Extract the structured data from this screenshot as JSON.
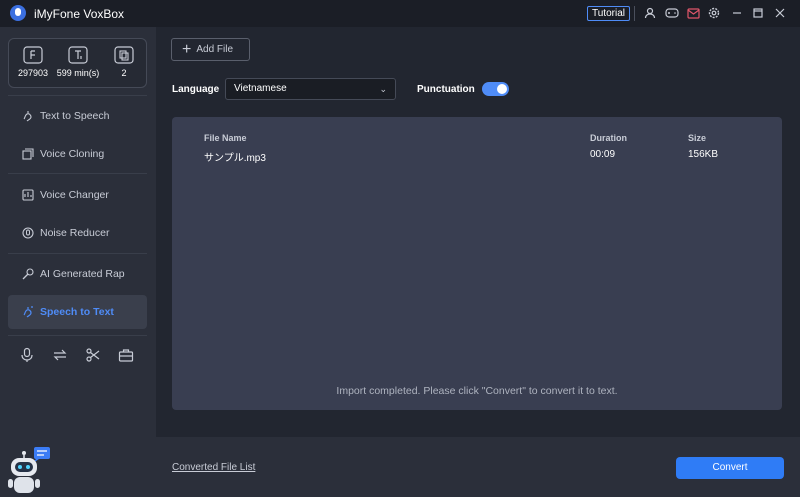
{
  "app": {
    "title": "iMyFone VoxBox",
    "accent": "#4f8cf7"
  },
  "titlebar": {
    "tutorial_label": "Tutorial",
    "icons": [
      "user-icon",
      "gamepad-icon",
      "mail-icon",
      "settings-icon",
      "minimize-icon",
      "maximize-icon",
      "close-icon"
    ]
  },
  "stats": [
    {
      "icon": "characters-icon",
      "value": "297903"
    },
    {
      "icon": "minutes-icon",
      "value": "599 min(s)"
    },
    {
      "icon": "files-icon",
      "value": "2"
    }
  ],
  "sidebar": {
    "items": [
      {
        "label": "Text to Speech",
        "icon": "text-to-speech-icon"
      },
      {
        "label": "Voice Cloning",
        "icon": "voice-cloning-icon"
      },
      {
        "label": "Voice Changer",
        "icon": "voice-changer-icon"
      },
      {
        "label": "Noise Reducer",
        "icon": "noise-reducer-icon"
      },
      {
        "label": "AI Generated Rap",
        "icon": "ai-rap-icon"
      },
      {
        "label": "Speech to Text",
        "icon": "speech-to-text-icon",
        "active": true
      }
    ],
    "tools": [
      "microphone-icon",
      "convert-icon",
      "scissors-icon",
      "toolbox-icon"
    ]
  },
  "main": {
    "add_file_label": "Add File",
    "language_label": "Language",
    "language_value": "Vietnamese",
    "punctuation_label": "Punctuation",
    "punctuation_on": true,
    "table": {
      "headers": {
        "name": "File Name",
        "duration": "Duration",
        "size": "Size"
      },
      "rows": [
        {
          "name": "サンプル.mp3",
          "duration": "00:09",
          "size": "156KB"
        }
      ]
    },
    "status_message": "Import completed. Please click \"Convert\" to convert it to text."
  },
  "footer": {
    "converted_list_label": "Converted File List",
    "convert_label": "Convert"
  }
}
